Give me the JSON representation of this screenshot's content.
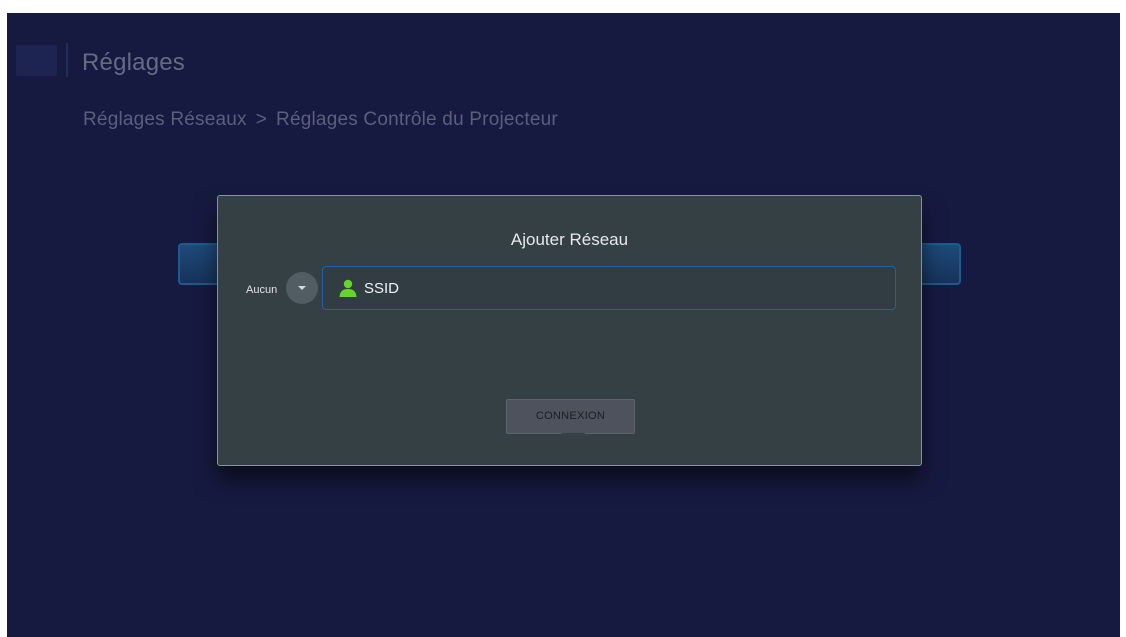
{
  "header": {
    "title": "Réglages"
  },
  "breadcrumb": {
    "parent": "Réglages Réseaux",
    "separator": ">",
    "current": "Réglages Contrôle du Projecteur"
  },
  "dialog": {
    "title": "Ajouter Réseau",
    "security": {
      "selected": "Aucun",
      "icon": "chevron-down-icon"
    },
    "ssid": {
      "value": "",
      "placeholder": "SSID",
      "icon": "user-icon",
      "icon_color": "#66d42a"
    },
    "connect_label": "CONNEXION"
  },
  "colors": {
    "background": "#171a40",
    "dialog": "#354045",
    "dialog_border": "#3cc94a",
    "field_border": "#1f5ea8"
  }
}
